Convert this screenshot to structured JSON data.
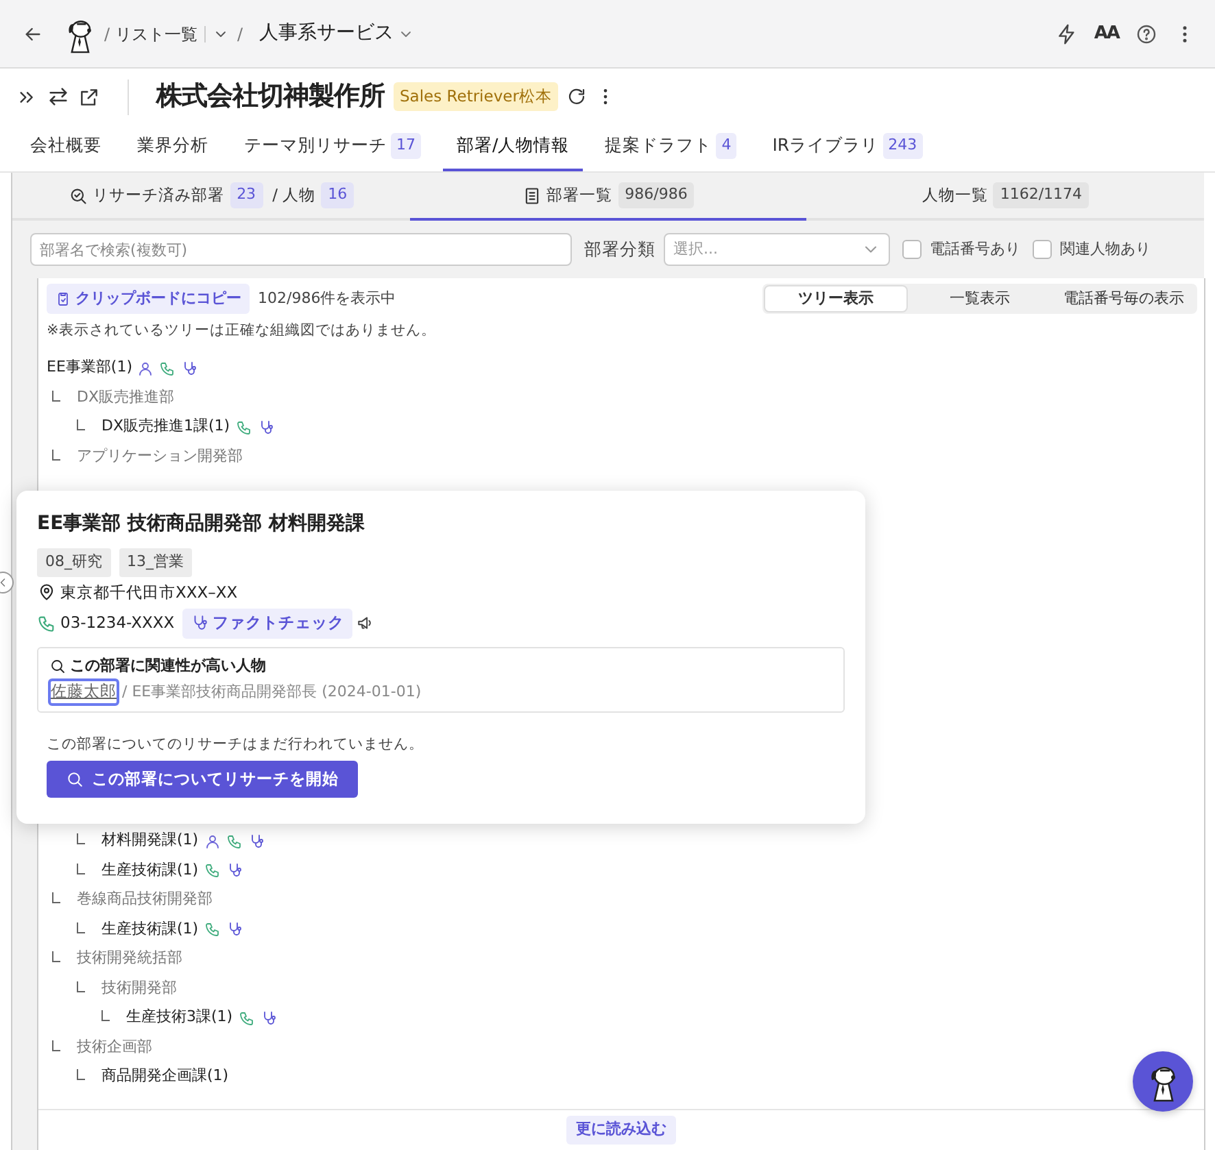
{
  "topbar": {
    "separators": [
      "/",
      "/"
    ],
    "breadcrumb": "リスト一覧",
    "current": "人事系サービス",
    "font_button": "AA"
  },
  "company": {
    "name": "株式会社切神製作所",
    "owner_badge": "Sales Retriever松本"
  },
  "tabs": [
    {
      "label": "会社概要",
      "selected": false
    },
    {
      "label": "業界分析",
      "selected": false
    },
    {
      "label": "テーマ別リサーチ",
      "count": "17",
      "selected": false
    },
    {
      "label": "部署/人物情報",
      "selected": true
    },
    {
      "label": "提案ドラフト",
      "count": "4",
      "selected": false
    },
    {
      "label": "IRライブラリ",
      "count": "243",
      "selected": false
    }
  ],
  "subtabs": [
    {
      "kind": "researched",
      "label": "リサーチ済み部署",
      "count": "23",
      "label2": "/ 人物",
      "count2": "16",
      "selected": false
    },
    {
      "kind": "departments",
      "label": "部署一覧",
      "count": "986/986",
      "selected": true
    },
    {
      "kind": "people",
      "label": "人物一覧",
      "count": "1162/1174",
      "selected": false
    }
  ],
  "filters": {
    "search_placeholder": "部署名で検索(複数可)",
    "category_label": "部署分類",
    "select_placeholder": "選択...",
    "checkboxes": [
      {
        "label": "電話番号あり",
        "checked": false
      },
      {
        "label": "関連人物あり",
        "checked": false
      }
    ]
  },
  "toolbar": {
    "copy_button": "クリップボードにコピー",
    "shown_count": "102/986件を表示中",
    "views": [
      {
        "label": "ツリー表示",
        "selected": true
      },
      {
        "label": "一覧表示",
        "selected": false
      },
      {
        "label": "電話番号毎の表示",
        "selected": false
      }
    ]
  },
  "note": "※表示されているツリーは正確な組織図ではありません。",
  "tree": [
    {
      "label": "EE事業部(1)",
      "muted": false,
      "has_person": true,
      "has_phone": true,
      "has_research": true,
      "children": [
        {
          "label": "DX販売推進部",
          "muted": true,
          "children": [
            {
              "label": "DX販売推進1課(1)",
              "muted": false,
              "has_phone": true,
              "has_research": true
            }
          ]
        },
        {
          "label": "アプリケーション開発部",
          "muted": true
        },
        {
          "children": [
            {
              "label": "材料開発課(1)",
              "muted": false,
              "has_person": true,
              "has_phone": true,
              "has_research": true
            },
            {
              "label": "生産技術課(1)",
              "muted": false,
              "has_phone": true,
              "has_research": true
            }
          ]
        },
        {
          "label": "巻線商品技術開発部",
          "muted": true,
          "children": [
            {
              "label": "生産技術課(1)",
              "muted": false,
              "has_phone": true,
              "has_research": true
            }
          ]
        },
        {
          "label": "技術開発統括部",
          "muted": true,
          "children": [
            {
              "label": "技術開発部",
              "muted": true,
              "children": [
                {
                  "label": "生産技術3課(1)",
                  "muted": false,
                  "has_phone": true,
                  "has_research": true
                }
              ]
            }
          ]
        },
        {
          "label": "技術企画部",
          "muted": true,
          "children": [
            {
              "label": "商品開発企画課(1)",
              "muted": false
            }
          ]
        }
      ]
    }
  ],
  "popup": {
    "title": "EE事業部 技術商品開発部 材料開発課",
    "tags": [
      "08_研究",
      "13_営業"
    ],
    "address": "東京都千代田市XXX–XX",
    "phone": "03-1234-XXXX",
    "factcheck_button": "ファクトチェック",
    "related": {
      "heading": "この部署に関連性が高い人物",
      "person": "佐藤太郎",
      "focused": true,
      "detail": "/ EE事業部技術商品開発部長 (2024-01-01)"
    },
    "no_research": "この部署についてのリサーチはまだ行われていません。",
    "research_button": "この部署についてリサーチを開始"
  },
  "load_more": "更に読み込む"
}
